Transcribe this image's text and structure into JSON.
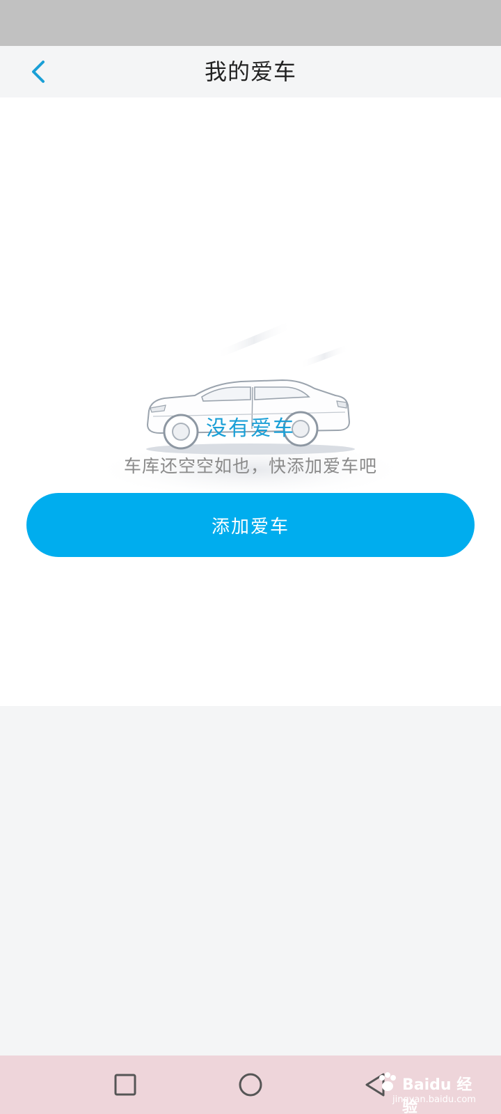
{
  "header": {
    "title": "我的爱车"
  },
  "empty_state": {
    "title": "没有爱车",
    "subtitle": "车库还空空如也，快添加爱车吧",
    "button_label": "添加爱车"
  },
  "watermark": {
    "brand": "Baidu 经验",
    "url": "jingyan.baidu.com"
  },
  "colors": {
    "accent": "#00adee",
    "title_blue": "#1a9fd6",
    "status_bar": "#c1c1c1",
    "nav_bar_bg": "#eed5da"
  },
  "icons": {
    "back": "chevron-left-icon",
    "recent": "square-icon",
    "home": "circle-icon",
    "back_system": "triangle-left-icon"
  }
}
